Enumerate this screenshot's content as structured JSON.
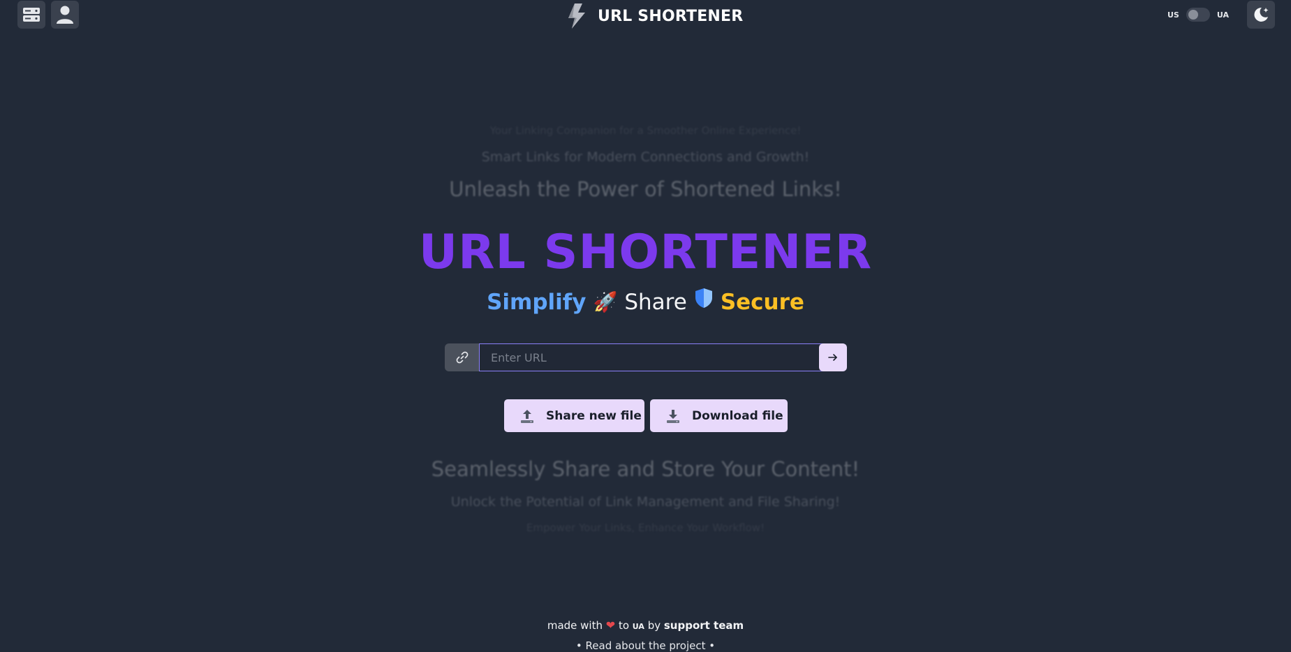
{
  "header": {
    "title": "URL SHORTENER",
    "lang_left": "US",
    "lang_right": "UA"
  },
  "taglines": {
    "line1": "Your Linking Companion for a Smoother Online Experience!",
    "line2": "Smart Links for Modern Connections and Growth!",
    "line3": "Unleash the Power of Shortened Links!",
    "line4": "Seamlessly Share and Store Your Content!",
    "line5": "Unlock the Potential of Link Management and File Sharing!",
    "line6": "Empower Your Links, Enhance Your Workflow!"
  },
  "hero": {
    "title": "URL SHORTENER",
    "motto_simplify": "Simplify",
    "motto_rocket": "🚀",
    "motto_share": "Share",
    "motto_shield": "🛡️",
    "motto_secure": "Secure"
  },
  "url_form": {
    "placeholder": "Enter URL",
    "value": ""
  },
  "actions": {
    "share_label": "Share new file",
    "download_label": "Download file"
  },
  "footer": {
    "made_with": "made with",
    "heart": "❤",
    "to": "to",
    "ua_mark": "UA",
    "by": "by",
    "team": "support team",
    "read_about": "• Read about the project •"
  },
  "colors": {
    "background": "#222a38",
    "accent_purple": "#7c3aed",
    "simplify_blue": "#60a5fa",
    "secure_yellow": "#fbbf24",
    "button_lavender": "#e8d9fb"
  }
}
